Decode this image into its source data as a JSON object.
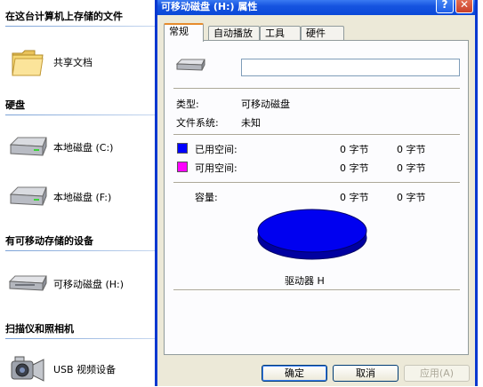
{
  "explorer": {
    "group_stored": "在这台计算机上存储的文件",
    "shared_docs": "共享文档",
    "group_hdd": "硬盘",
    "disk_c": "本地磁盘 (C:)",
    "disk_f": "本地磁盘 (F:)",
    "group_removable": "有可移动存储的设备",
    "removable_h": "可移动磁盘 (H:)",
    "group_scanners": "扫描仪和照相机",
    "usb_video": "USB 视频设备"
  },
  "dialog": {
    "title": "可移动磁盘 (H:) 属性",
    "help_glyph": "?",
    "close_glyph": "✕",
    "tabs": [
      {
        "label": "常规"
      },
      {
        "label": "自动播放"
      },
      {
        "label": "工具"
      },
      {
        "label": "硬件"
      }
    ],
    "name_value": "",
    "type_label": "类型:",
    "type_value": "可移动磁盘",
    "fs_label": "文件系统:",
    "fs_value": "未知",
    "used_label": "已用空间:",
    "used_bytes": "0 字节",
    "used_size": "0 字节",
    "free_label": "可用空间:",
    "free_bytes": "0 字节",
    "free_size": "0 字节",
    "capacity_label": "容量:",
    "capacity_bytes": "0 字节",
    "capacity_size": "0 字节",
    "drive_label": "驱动器 H",
    "used_color": "#0000ff",
    "free_color": "#ff00ff",
    "ok_label": "确定",
    "cancel_label": "取消",
    "apply_label": "应用(A)"
  }
}
